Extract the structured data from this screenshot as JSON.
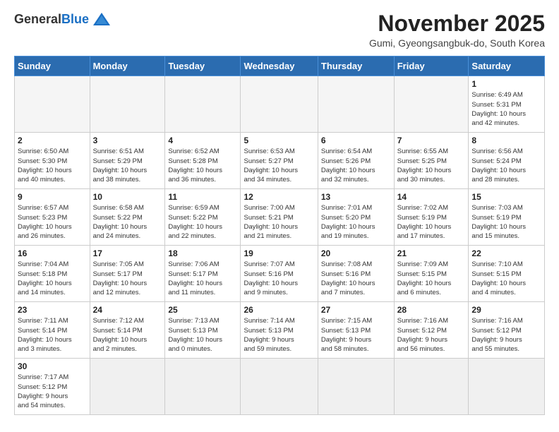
{
  "header": {
    "logo_general": "General",
    "logo_blue": "Blue",
    "month": "November 2025",
    "location": "Gumi, Gyeongsangbuk-do, South Korea"
  },
  "weekdays": [
    "Sunday",
    "Monday",
    "Tuesday",
    "Wednesday",
    "Thursday",
    "Friday",
    "Saturday"
  ],
  "weeks": [
    [
      {
        "day": "",
        "info": ""
      },
      {
        "day": "",
        "info": ""
      },
      {
        "day": "",
        "info": ""
      },
      {
        "day": "",
        "info": ""
      },
      {
        "day": "",
        "info": ""
      },
      {
        "day": "",
        "info": ""
      },
      {
        "day": "1",
        "info": "Sunrise: 6:49 AM\nSunset: 5:31 PM\nDaylight: 10 hours\nand 42 minutes."
      }
    ],
    [
      {
        "day": "2",
        "info": "Sunrise: 6:50 AM\nSunset: 5:30 PM\nDaylight: 10 hours\nand 40 minutes."
      },
      {
        "day": "3",
        "info": "Sunrise: 6:51 AM\nSunset: 5:29 PM\nDaylight: 10 hours\nand 38 minutes."
      },
      {
        "day": "4",
        "info": "Sunrise: 6:52 AM\nSunset: 5:28 PM\nDaylight: 10 hours\nand 36 minutes."
      },
      {
        "day": "5",
        "info": "Sunrise: 6:53 AM\nSunset: 5:27 PM\nDaylight: 10 hours\nand 34 minutes."
      },
      {
        "day": "6",
        "info": "Sunrise: 6:54 AM\nSunset: 5:26 PM\nDaylight: 10 hours\nand 32 minutes."
      },
      {
        "day": "7",
        "info": "Sunrise: 6:55 AM\nSunset: 5:25 PM\nDaylight: 10 hours\nand 30 minutes."
      },
      {
        "day": "8",
        "info": "Sunrise: 6:56 AM\nSunset: 5:24 PM\nDaylight: 10 hours\nand 28 minutes."
      }
    ],
    [
      {
        "day": "9",
        "info": "Sunrise: 6:57 AM\nSunset: 5:23 PM\nDaylight: 10 hours\nand 26 minutes."
      },
      {
        "day": "10",
        "info": "Sunrise: 6:58 AM\nSunset: 5:22 PM\nDaylight: 10 hours\nand 24 minutes."
      },
      {
        "day": "11",
        "info": "Sunrise: 6:59 AM\nSunset: 5:22 PM\nDaylight: 10 hours\nand 22 minutes."
      },
      {
        "day": "12",
        "info": "Sunrise: 7:00 AM\nSunset: 5:21 PM\nDaylight: 10 hours\nand 21 minutes."
      },
      {
        "day": "13",
        "info": "Sunrise: 7:01 AM\nSunset: 5:20 PM\nDaylight: 10 hours\nand 19 minutes."
      },
      {
        "day": "14",
        "info": "Sunrise: 7:02 AM\nSunset: 5:19 PM\nDaylight: 10 hours\nand 17 minutes."
      },
      {
        "day": "15",
        "info": "Sunrise: 7:03 AM\nSunset: 5:19 PM\nDaylight: 10 hours\nand 15 minutes."
      }
    ],
    [
      {
        "day": "16",
        "info": "Sunrise: 7:04 AM\nSunset: 5:18 PM\nDaylight: 10 hours\nand 14 minutes."
      },
      {
        "day": "17",
        "info": "Sunrise: 7:05 AM\nSunset: 5:17 PM\nDaylight: 10 hours\nand 12 minutes."
      },
      {
        "day": "18",
        "info": "Sunrise: 7:06 AM\nSunset: 5:17 PM\nDaylight: 10 hours\nand 11 minutes."
      },
      {
        "day": "19",
        "info": "Sunrise: 7:07 AM\nSunset: 5:16 PM\nDaylight: 10 hours\nand 9 minutes."
      },
      {
        "day": "20",
        "info": "Sunrise: 7:08 AM\nSunset: 5:16 PM\nDaylight: 10 hours\nand 7 minutes."
      },
      {
        "day": "21",
        "info": "Sunrise: 7:09 AM\nSunset: 5:15 PM\nDaylight: 10 hours\nand 6 minutes."
      },
      {
        "day": "22",
        "info": "Sunrise: 7:10 AM\nSunset: 5:15 PM\nDaylight: 10 hours\nand 4 minutes."
      }
    ],
    [
      {
        "day": "23",
        "info": "Sunrise: 7:11 AM\nSunset: 5:14 PM\nDaylight: 10 hours\nand 3 minutes."
      },
      {
        "day": "24",
        "info": "Sunrise: 7:12 AM\nSunset: 5:14 PM\nDaylight: 10 hours\nand 2 minutes."
      },
      {
        "day": "25",
        "info": "Sunrise: 7:13 AM\nSunset: 5:13 PM\nDaylight: 10 hours\nand 0 minutes."
      },
      {
        "day": "26",
        "info": "Sunrise: 7:14 AM\nSunset: 5:13 PM\nDaylight: 9 hours\nand 59 minutes."
      },
      {
        "day": "27",
        "info": "Sunrise: 7:15 AM\nSunset: 5:13 PM\nDaylight: 9 hours\nand 58 minutes."
      },
      {
        "day": "28",
        "info": "Sunrise: 7:16 AM\nSunset: 5:12 PM\nDaylight: 9 hours\nand 56 minutes."
      },
      {
        "day": "29",
        "info": "Sunrise: 7:16 AM\nSunset: 5:12 PM\nDaylight: 9 hours\nand 55 minutes."
      }
    ],
    [
      {
        "day": "30",
        "info": "Sunrise: 7:17 AM\nSunset: 5:12 PM\nDaylight: 9 hours\nand 54 minutes."
      },
      {
        "day": "",
        "info": ""
      },
      {
        "day": "",
        "info": ""
      },
      {
        "day": "",
        "info": ""
      },
      {
        "day": "",
        "info": ""
      },
      {
        "day": "",
        "info": ""
      },
      {
        "day": "",
        "info": ""
      }
    ]
  ]
}
